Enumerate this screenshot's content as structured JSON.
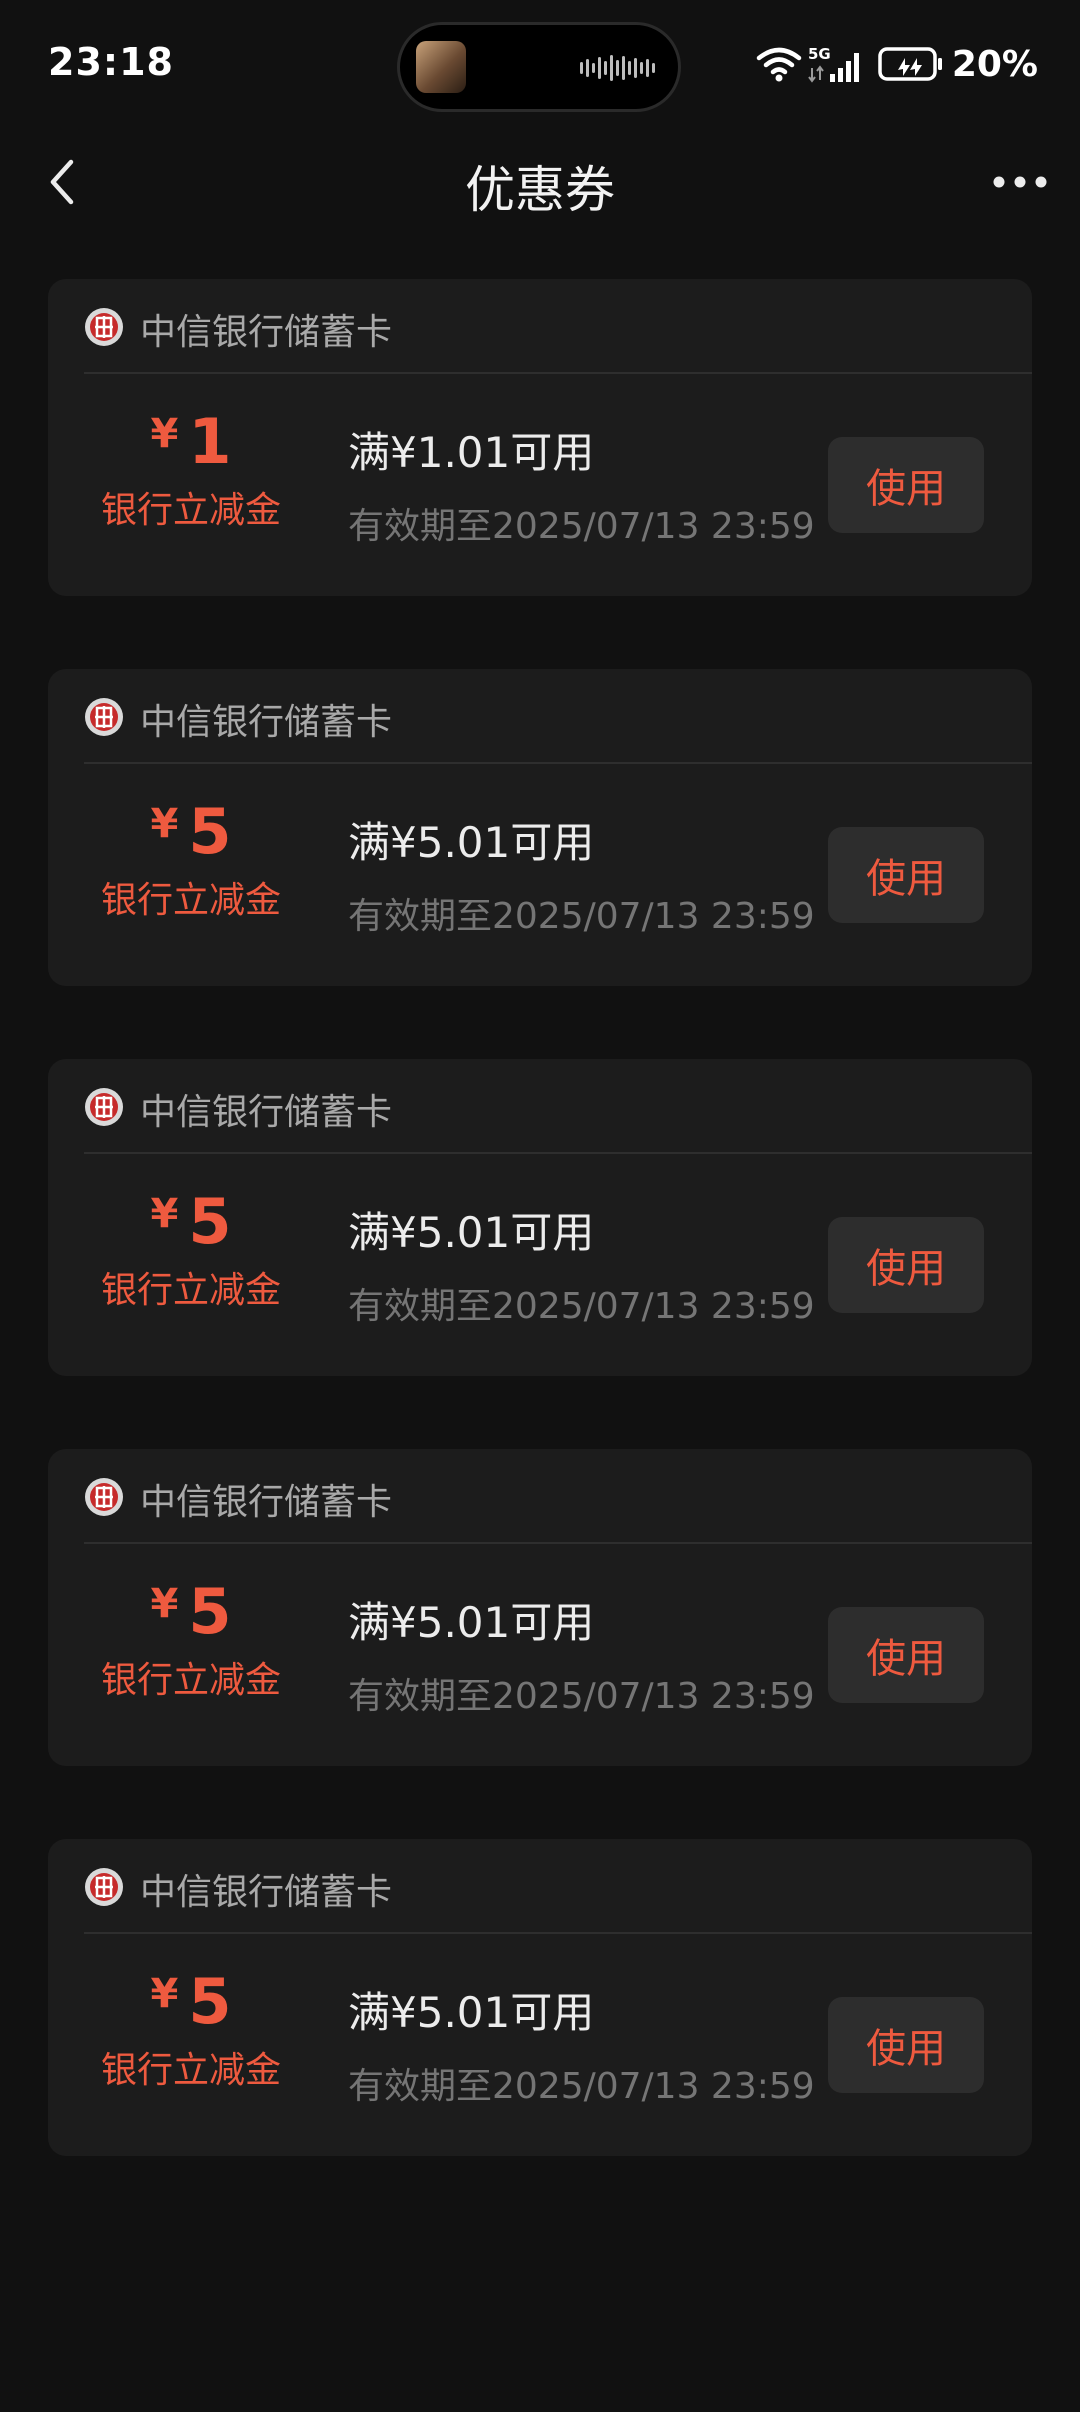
{
  "status_bar": {
    "time": "23:18",
    "battery_percent": "20%",
    "network": "5G"
  },
  "nav": {
    "title": "优惠券"
  },
  "colors": {
    "background": "#111111",
    "card": "#1c1c1c",
    "accent": "#ee5a3f",
    "button_bg": "#2d2d2d"
  },
  "coupons": [
    {
      "bank": "中信银行储蓄卡",
      "currency": "¥",
      "amount": "1",
      "type": "银行立减金",
      "condition": "满¥1.01可用",
      "validity": "有效期至2025/07/13 23:59",
      "button": "使用"
    },
    {
      "bank": "中信银行储蓄卡",
      "currency": "¥",
      "amount": "5",
      "type": "银行立减金",
      "condition": "满¥5.01可用",
      "validity": "有效期至2025/07/13 23:59",
      "button": "使用"
    },
    {
      "bank": "中信银行储蓄卡",
      "currency": "¥",
      "amount": "5",
      "type": "银行立减金",
      "condition": "满¥5.01可用",
      "validity": "有效期至2025/07/13 23:59",
      "button": "使用"
    },
    {
      "bank": "中信银行储蓄卡",
      "currency": "¥",
      "amount": "5",
      "type": "银行立减金",
      "condition": "满¥5.01可用",
      "validity": "有效期至2025/07/13 23:59",
      "button": "使用"
    },
    {
      "bank": "中信银行储蓄卡",
      "currency": "¥",
      "amount": "5",
      "type": "银行立减金",
      "condition": "满¥5.01可用",
      "validity": "有效期至2025/07/13 23:59",
      "button": "使用"
    }
  ]
}
